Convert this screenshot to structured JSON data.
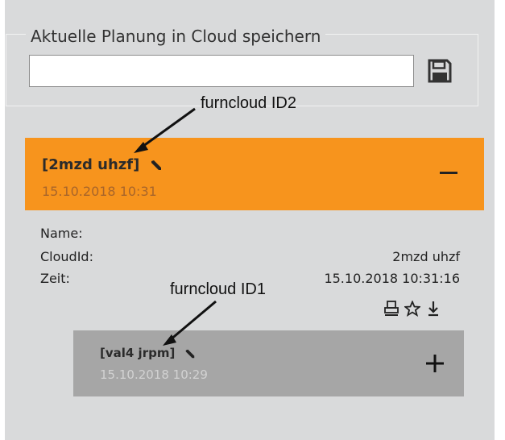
{
  "save_section": {
    "title": "Aktuelle Planung in Cloud speichern",
    "input_value": "",
    "save_icon": "floppy-disk-icon"
  },
  "annotations": {
    "label_top": "furncloud ID2",
    "label_bottom": "furncloud ID1"
  },
  "entries": [
    {
      "title": "[2mzd uhzf]",
      "time": "15.10.2018 10:31",
      "state": "expanded",
      "toggle_icon": "minus-icon",
      "details": {
        "name_label": "Name:",
        "name_value": "",
        "cloudid_label": "CloudId:",
        "cloudid_value": "2mzd uhzf",
        "zeit_label": "Zeit:",
        "zeit_value": "15.10.2018 10:31:16"
      },
      "actions": [
        "print-icon",
        "star-icon",
        "download-icon"
      ]
    },
    {
      "title": "[val4 jrpm]",
      "time": "15.10.2018 10:29",
      "state": "collapsed",
      "toggle_icon": "plus-icon"
    }
  ],
  "colors": {
    "panel_bg": "#d9dadb",
    "active_entry": "#f7941d",
    "inactive_entry": "#a6a6a6"
  }
}
